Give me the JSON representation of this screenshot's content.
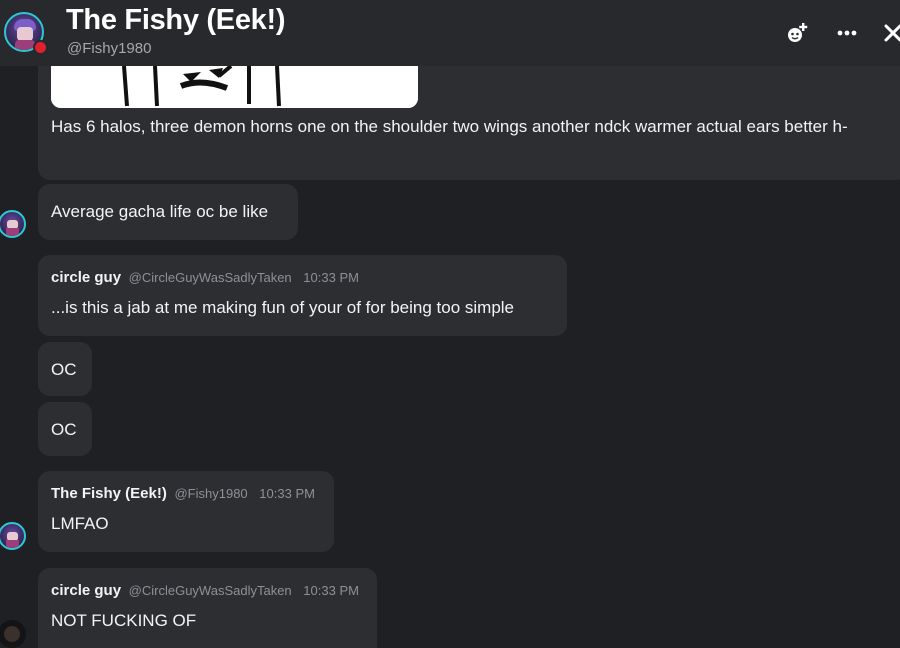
{
  "header": {
    "title": "The Fishy (Eek!)",
    "handle": "@Fishy1980",
    "icons": {
      "avatar": "user-avatar",
      "status": "dnd-status-dot",
      "add_friend": "add-friend-icon",
      "more": "more-options-icon",
      "close": "close-icon"
    }
  },
  "colors": {
    "background": "#1e2023",
    "header": "#27292c",
    "bubble": "#2c2e32",
    "status_dnd": "#e0212d",
    "avatar_ring": "#2ec7d6"
  },
  "messages": [
    {
      "id": "m1",
      "text": "Has 6 halos, three demon horns one on the shoulder two wings another ndck warmer actual ears better h-",
      "has_image": true
    },
    {
      "id": "m2",
      "text": "Average gacha life oc be like"
    },
    {
      "id": "m3",
      "author": "circle guy",
      "handle": "@CircleGuyWasSadlyTaken",
      "time": "10:33 PM",
      "text": "...is this a jab at me making fun of your of for being too simple"
    },
    {
      "id": "m4",
      "text": "OC"
    },
    {
      "id": "m5",
      "text": "OC"
    },
    {
      "id": "m6",
      "author": "The Fishy (Eek!)",
      "handle": "@Fishy1980",
      "time": "10:33 PM",
      "text": "LMFAO"
    },
    {
      "id": "m7",
      "author": "circle guy",
      "handle": "@CircleGuyWasSadlyTaken",
      "time": "10:33 PM",
      "text": "NOT FUCKING OF"
    }
  ]
}
